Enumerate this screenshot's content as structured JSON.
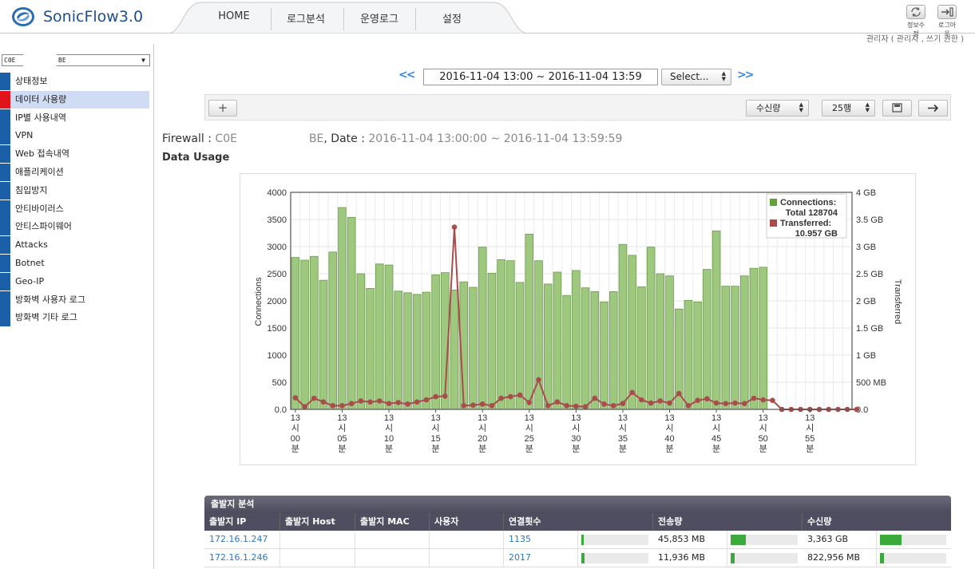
{
  "app": {
    "title": "SonicFlow3.0"
  },
  "nav": [
    "HOME",
    "로그분석",
    "운영로그",
    "설정"
  ],
  "top_icons": [
    {
      "label": "정보수정",
      "icon": "refresh-icon"
    },
    {
      "label": "로그아웃",
      "icon": "logout-icon"
    }
  ],
  "user_info": "관리자 ( 관리자 , 쓰기 권한 )",
  "firewall_select": {
    "value": "C0E",
    "suffix": "BE"
  },
  "sidebar": {
    "items": [
      "상태정보",
      "데이터 사용량",
      "IP별 사용내역",
      "VPN",
      "Web 접속내역",
      "애플리케이션",
      "침입방지",
      "안티바이러스",
      "안티스파이웨어",
      "Attacks",
      "Botnet",
      "Geo-IP",
      "방화벽 사용자 로그",
      "방화벽 기타 로그"
    ],
    "active_index": 1
  },
  "daterange": {
    "prev": "<<",
    "value": "2016-11-04 13:00 ~ 2016-11-04 13:59",
    "select": "Select...",
    "next": ">>"
  },
  "toolbar": {
    "add": "+",
    "sort": "수신량",
    "rows": "25행"
  },
  "info": {
    "fw_label": "Firewall :",
    "fw_value": "C0E",
    "fw_suffix": "BE",
    "date_label": ", Date :",
    "date_value": "2016-11-04 13:00:00 ~ 2016-11-04 13:59:59"
  },
  "section_title": "Data Usage",
  "chart_data": {
    "type": "bar+line",
    "ylabel_left": "Connections",
    "ylabel_right": "Transferred",
    "yticks_left": [
      "4000",
      "3500",
      "3000",
      "2500",
      "2000",
      "1500",
      "1000",
      "500",
      "0.0"
    ],
    "yticks_right": [
      "4 GB",
      "3.5 GB",
      "3 GB",
      "2.5 GB",
      "2 GB",
      "1.5 GB",
      "1 GB",
      "500 MB",
      "0.0"
    ],
    "ylim_left": [
      0,
      4000
    ],
    "ylim_right_mb": [
      0,
      4096
    ],
    "grid": true,
    "legend_position": "top-right",
    "legend": [
      {
        "name": "Connections:",
        "sub": "Total 128704",
        "color": "#63a13a"
      },
      {
        "name": "Transferred:",
        "sub": "10.957 GB",
        "color": "#a84c4c"
      }
    ],
    "xtick_labels": [
      [
        "13",
        "시",
        "00",
        "분"
      ],
      [
        "13",
        "시",
        "05",
        "분"
      ],
      [
        "13",
        "시",
        "10",
        "분"
      ],
      [
        "13",
        "시",
        "15",
        "분"
      ],
      [
        "13",
        "시",
        "20",
        "분"
      ],
      [
        "13",
        "시",
        "25",
        "분"
      ],
      [
        "13",
        "시",
        "30",
        "분"
      ],
      [
        "13",
        "시",
        "35",
        "분"
      ],
      [
        "13",
        "시",
        "40",
        "분"
      ],
      [
        "13",
        "시",
        "45",
        "분"
      ],
      [
        "13",
        "시",
        "50",
        "분"
      ],
      [
        "13",
        "시",
        "55",
        "분"
      ]
    ],
    "connections": [
      2800,
      2750,
      2820,
      2380,
      2900,
      3720,
      3540,
      2500,
      2230,
      2680,
      2660,
      2180,
      2150,
      2120,
      2160,
      2480,
      2520,
      2200,
      2350,
      2250,
      2990,
      2510,
      2760,
      2740,
      2340,
      3230,
      2740,
      2310,
      2530,
      2100,
      2560,
      2240,
      2170,
      1980,
      2170,
      3040,
      2840,
      2260,
      2990,
      2500,
      2460,
      1850,
      2010,
      1980,
      2580,
      3290,
      2270,
      2270,
      2460,
      2600,
      2620,
      null,
      null,
      null,
      null,
      null,
      null,
      null,
      null,
      null
    ],
    "transferred_mb": [
      220,
      50,
      210,
      140,
      70,
      70,
      110,
      160,
      140,
      160,
      110,
      130,
      100,
      140,
      180,
      240,
      250,
      3440,
      70,
      80,
      100,
      70,
      210,
      240,
      270,
      130,
      560,
      70,
      140,
      70,
      60,
      50,
      210,
      100,
      70,
      110,
      320,
      180,
      120,
      160,
      120,
      300,
      70,
      170,
      200,
      120,
      110,
      120,
      110,
      210,
      180,
      170,
      0,
      0,
      0,
      0,
      0,
      0,
      0,
      0,
      0
    ]
  },
  "table": {
    "title": "출발지 분석",
    "columns": [
      "출발지 IP",
      "출발지 Host",
      "출발지 MAC",
      "사용자",
      "연결횟수",
      "전송량",
      "수신량"
    ],
    "rows": [
      {
        "ip": "172.16.1.247",
        "host": "",
        "mac": "",
        "user": "",
        "count": "1135",
        "count_pct": 0.03,
        "sent": "45,853 MB",
        "sent_pct": 0.23,
        "recv": "3,363 GB",
        "recv_pct": 0.33
      },
      {
        "ip": "172.16.1.246",
        "host": "",
        "mac": "",
        "user": "",
        "count": "2017",
        "count_pct": 0.05,
        "sent": "11,936 MB",
        "sent_pct": 0.06,
        "recv": "822,956 MB",
        "recv_pct": 0.06
      }
    ]
  },
  "colors": {
    "accent": "#1b5fa8",
    "active": "#e0141b",
    "bar": "#9fc87f",
    "line": "#a84c4c",
    "link": "#2b78c0"
  }
}
